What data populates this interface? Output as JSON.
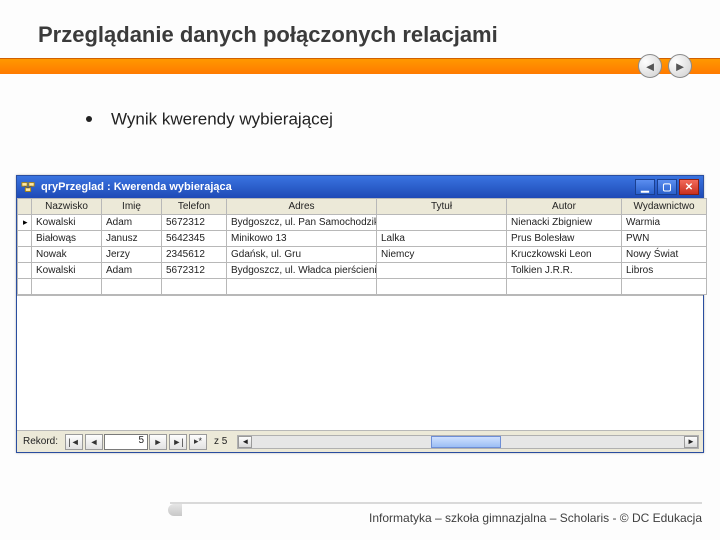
{
  "slide": {
    "title": "Przeglądanie danych  połączonych relacjami",
    "bullet": "Wynik kwerendy wybierającej"
  },
  "window": {
    "title": "qryPrzeglad : Kwerenda wybierająca",
    "columns": [
      "Nazwisko",
      "Imię",
      "Telefon",
      "Adres",
      "Tytuł",
      "Autor",
      "Wydawnictwo"
    ],
    "rows": [
      {
        "Nazwisko": "Kowalski",
        "Imię": "Adam",
        "Telefon": "5672312",
        "Adres": "Bydgoszcz, ul. Pan Samochodzik i niesamowity dwór",
        "Tytuł": "",
        "Autor": "Nienacki Zbigniew",
        "Wydawnictwo": "Warmia"
      },
      {
        "Nazwisko": "Białowąs",
        "Imię": "Janusz",
        "Telefon": "5642345",
        "Adres": "Minikowo 13",
        "Tytuł": "Lalka",
        "Autor": "Prus Bolesław",
        "Wydawnictwo": "PWN"
      },
      {
        "Nazwisko": "Nowak",
        "Imię": "Jerzy",
        "Telefon": "2345612",
        "Adres": "Gdańsk, ul. Gru",
        "Tytuł": "Niemcy",
        "Autor": "Kruczkowski Leon",
        "Wydawnictwo": "Nowy Świat"
      },
      {
        "Nazwisko": "Kowalski",
        "Imię": "Adam",
        "Telefon": "5672312",
        "Adres": "Bydgoszcz, ul. Władca pierścieni, drużyna pierścienia",
        "Tytuł": "",
        "Autor": "Tolkien J.R.R.",
        "Wydawnictwo": "Libros"
      }
    ],
    "record_nav": {
      "label": "Rekord:",
      "current": "5",
      "total_label": "z 5"
    }
  },
  "footer": "Informatyka – szkoła gimnazjalna – Scholaris - © DC Edukacja"
}
